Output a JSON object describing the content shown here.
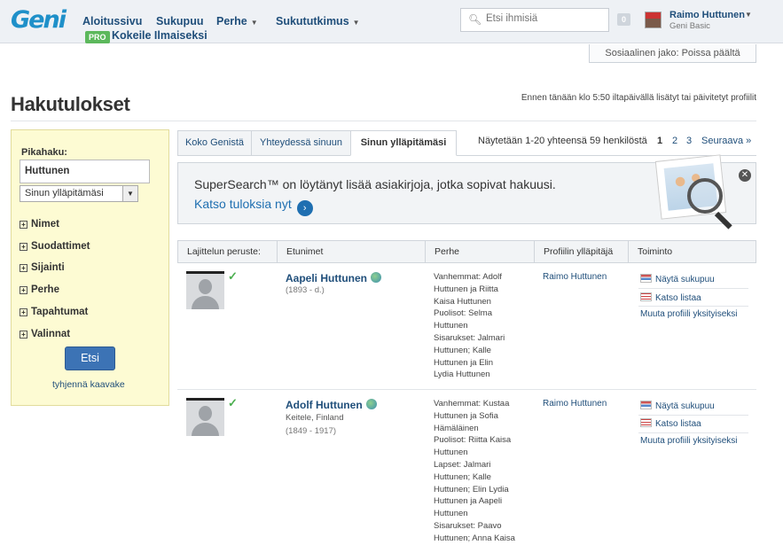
{
  "header": {
    "logo": "Geni",
    "nav": [
      {
        "label": "Aloitussivu",
        "has_menu": false
      },
      {
        "label": "Sukupuu",
        "has_menu": false
      },
      {
        "label": "Perhe",
        "has_menu": true
      },
      {
        "label": "Sukututkimus",
        "has_menu": true
      }
    ],
    "pro_badge": "PRO",
    "try_free": "Kokeile Ilmaiseksi",
    "search_placeholder": "Etsi ihmisiä",
    "notification_count": "0",
    "user_name": "Raimo Huttunen",
    "user_plan": "Geni Basic"
  },
  "social_sharing": "Sosiaalinen jako: Poissa päältä",
  "page_title": "Hakutulokset",
  "updated_note": "Ennen tänään klo 5:50 iltapäivällä lisätyt tai päivitetyt profiilit",
  "sidebar": {
    "quick_search_label": "Pikahaku:",
    "quick_search_value": "Huttunen",
    "scope_select": "Sinun ylläpitämäsi",
    "sections": [
      "Nimet",
      "Suodattimet",
      "Sijainti",
      "Perhe",
      "Tapahtumat",
      "Valinnat"
    ],
    "search_button": "Etsi",
    "clear_form": "tyhjennä kaavake"
  },
  "tabs": [
    {
      "label": "Koko Genistä",
      "active": false
    },
    {
      "label": "Yhteydessä sinuun",
      "active": false
    },
    {
      "label": "Sinun ylläpitämäsi",
      "active": true
    }
  ],
  "paging": {
    "summary": "Näytetään 1-20 yhteensä 59 henkilöstä",
    "pages": [
      "1",
      "2",
      "3"
    ],
    "current": "1",
    "next": "Seuraava »"
  },
  "promo": {
    "text": "SuperSearch™ on löytänyt lisää asiakirjoja, jotka sopivat hakuusi.",
    "link": "Katso tuloksia nyt"
  },
  "table": {
    "columns": [
      "Lajittelun peruste:",
      "Etunimet",
      "Perhe",
      "Profiilin ylläpitäjä",
      "Toiminto"
    ],
    "rows": [
      {
        "name": "Aapeli Huttunen",
        "place": "",
        "dates": "(1893 - d.)",
        "family_lines": [
          "Vanhemmat: Adolf",
          "Huttunen ja Riitta",
          "Kaisa Huttunen",
          "Puolisot: Selma",
          "Huttunen",
          "Sisarukset: Jalmari",
          "Huttunen; Kalle",
          "Huttunen ja Elin",
          "Lydia Huttunen"
        ],
        "manager": "Raimo Huttunen",
        "actions": [
          "Näytä sukupuu",
          "Katso listaa",
          "Muuta profiili yksityiseksi"
        ]
      },
      {
        "name": "Adolf Huttunen",
        "place": "Keitele, Finland",
        "dates": "(1849 - 1917)",
        "family_lines": [
          "Vanhemmat: Kustaa",
          "Huttunen ja Sofia",
          "Hämäläinen",
          "Puolisot: Riitta Kaisa",
          "Huttunen",
          "Lapset: Jalmari",
          "Huttunen; Kalle",
          "Huttunen; Elin Lydia",
          "Huttunen ja Aapeli",
          "Huttunen",
          "Sisarukset: Paavo",
          "Huttunen; Anna Kaisa"
        ],
        "manager": "Raimo Huttunen",
        "actions": [
          "Näytä sukupuu",
          "Katso listaa",
          "Muuta profiili yksityiseksi"
        ]
      }
    ]
  }
}
